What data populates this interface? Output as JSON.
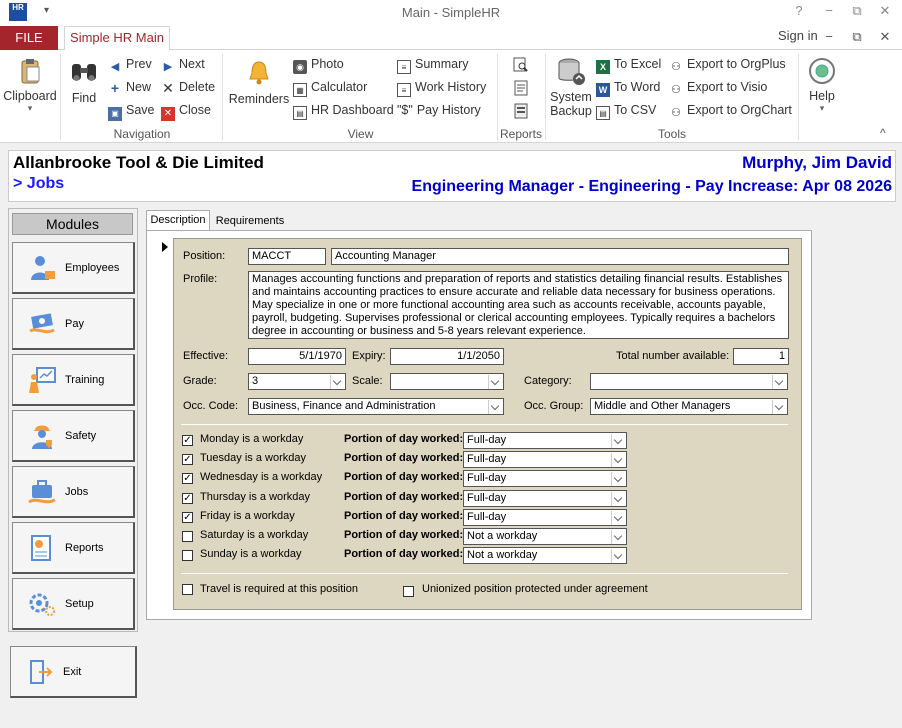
{
  "window": {
    "title": "Main - SimpleHR",
    "app_icon_text": "HR",
    "controls": {
      "help": "?",
      "minimize": "−",
      "restore": "⧉",
      "close": "✕"
    },
    "ribbon_controls": {
      "minimize": "−",
      "restore": "⧉",
      "close": "✕",
      "collapse": "^"
    }
  },
  "ribbon": {
    "file_tab": "FILE",
    "main_tab": "Simple HR Main",
    "sign_in": "Sign in",
    "clipboard": {
      "label": "Clipboard"
    },
    "navigation": {
      "group_label": "Navigation",
      "find": "Find",
      "prev": "Prev",
      "next": "Next",
      "new": "New",
      "delete": "Delete",
      "save": "Save",
      "close": "Close"
    },
    "view": {
      "group_label": "View",
      "reminders": "Reminders",
      "photo": "Photo",
      "calculator": "Calculator",
      "hr_dashboard": "HR Dashboard",
      "summary": "Summary",
      "work_history": "Work History",
      "pay_history": "Pay History",
      "pay_history_icon": "\"$\""
    },
    "reports": {
      "group_label": "Reports"
    },
    "tools": {
      "group_label": "Tools",
      "system_backup_1": "System",
      "system_backup_2": "Backup",
      "to_excel": "To Excel",
      "to_word": "To Word",
      "to_csv": "To CSV",
      "export_orgplus": "Export to OrgPlus",
      "export_visio": "Export to Visio",
      "export_orgchart": "Export to OrgChart"
    },
    "help": {
      "label": "Help"
    }
  },
  "header": {
    "company": "Allanbrooke Tool & Die Limited",
    "breadcrumb": "> Jobs",
    "employee_name": "Murphy, Jim David",
    "employee_info": "Engineering Manager - Engineering - Pay Increase: Apr 08 2026"
  },
  "modules": {
    "title": "Modules",
    "items": [
      {
        "label": "Employees"
      },
      {
        "label": "Pay"
      },
      {
        "label": "Training"
      },
      {
        "label": "Safety"
      },
      {
        "label": "Jobs"
      },
      {
        "label": "Reports"
      },
      {
        "label": "Setup"
      }
    ],
    "exit": "Exit"
  },
  "tabs": {
    "description": "Description",
    "requirements": "Requirements"
  },
  "form": {
    "position_label": "Position:",
    "position_code": "MACCT",
    "position_title": "Accounting Manager",
    "profile_label": "Profile:",
    "profile_text": "Manages accounting functions and preparation of reports and statistics detailing financial results. Establishes and maintains accounting practices to ensure accurate and reliable data necessary for business operations. May specialize in one or more functional accounting area such as accounts receivable, accounts payable, payroll, budgeting. Supervises professional or clerical accounting employees. Typically requires a bachelors degree in accounting or business and 5-8 years relevant experience.",
    "effective_label": "Effective:",
    "effective_value": "5/1/1970",
    "expiry_label": "Expiry:",
    "expiry_value": "1/1/2050",
    "total_label": "Total number available:",
    "total_value": "1",
    "grade_label": "Grade:",
    "grade_value": "3",
    "scale_label": "Scale:",
    "scale_value": "",
    "category_label": "Category:",
    "category_value": "",
    "occ_code_label": "Occ. Code:",
    "occ_code_value": "Business, Finance and Administration",
    "occ_group_label": "Occ. Group:",
    "occ_group_value": "Middle and Other Managers",
    "portion_label": "Portion of day worked:",
    "check_mark": "✓",
    "workdays": [
      {
        "label": "Monday is a workday",
        "checked": true,
        "portion": "Full-day"
      },
      {
        "label": "Tuesday is a workday",
        "checked": true,
        "portion": "Full-day"
      },
      {
        "label": "Wednesday is a workday",
        "checked": true,
        "portion": "Full-day"
      },
      {
        "label": "Thursday is a workday",
        "checked": true,
        "portion": "Full-day"
      },
      {
        "label": "Friday is a workday",
        "checked": true,
        "portion": "Full-day"
      },
      {
        "label": "Saturday is a workday",
        "checked": false,
        "portion": "Not a workday"
      },
      {
        "label": "Sunday is a workday",
        "checked": false,
        "portion": "Not a workday"
      }
    ],
    "travel_label": "Travel is required at this position",
    "travel_checked": false,
    "union_label": "Unionized position protected under agreement",
    "union_checked": false
  }
}
